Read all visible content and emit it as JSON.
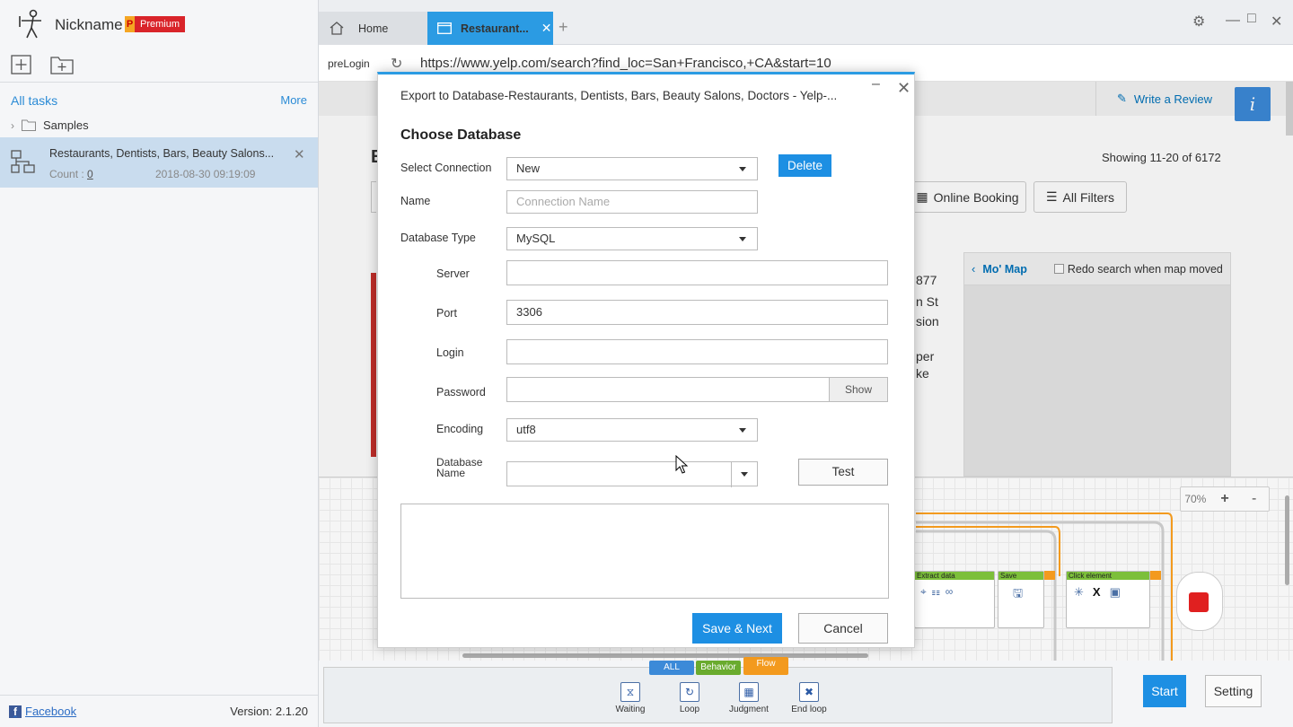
{
  "app": {
    "nickname": "Nickname",
    "premium_badge": "P",
    "premium_label": "Premium"
  },
  "sidebar": {
    "all_tasks": "All tasks",
    "more": "More",
    "folder": "Samples",
    "task": {
      "title": "Restaurants, Dentists, Bars, Beauty Salons...",
      "count_label": "Count : ",
      "count_value": "0",
      "date": "2018-08-30 09:19:09"
    },
    "facebook": "Facebook",
    "version": "Version: 2.1.20"
  },
  "tabs": {
    "home": "Home",
    "active": "Restaurant...",
    "plus": "+"
  },
  "address": {
    "prelogin": "preLogin",
    "url": "https://www.yelp.com/search?find_loc=San+Francisco,+CA&start=10"
  },
  "page": {
    "write_review": "Write a Review",
    "info": "i",
    "showing": "Showing 11-20 of 6172",
    "online_booking": "Online Booking",
    "all_filters": "All Filters",
    "mo_map": "Mo' Map",
    "redo_search": "Redo search when map moved",
    "frag_e": "E",
    "frag_877": "877",
    "frag_nst": "n St",
    "frag_sion": "sion",
    "frag_per": "per",
    "frag_ke": "ke"
  },
  "flow": {
    "zoom": "70%",
    "zoom_in": "+",
    "zoom_out": "-",
    "nodes": {
      "extract": "Extract data",
      "save": "Save",
      "click": "Click element"
    }
  },
  "palette": {
    "tabs": [
      "ALL",
      "Behavior",
      "Flow"
    ],
    "items": [
      "Waiting",
      "Loop",
      "Judgment",
      "End loop"
    ]
  },
  "bottom": {
    "start": "Start",
    "setting": "Setting"
  },
  "dialog": {
    "title": "Export to Database-Restaurants, Dentists, Bars, Beauty Salons, Doctors - Yelp-...",
    "heading": "Choose Database",
    "select_connection_label": "Select Connection",
    "select_connection_value": "New",
    "delete": "Delete",
    "name_label": "Name",
    "name_placeholder": "Connection Name",
    "db_type_label": "Database Type",
    "db_type_value": "MySQL",
    "server_label": "Server",
    "server_value": "",
    "port_label": "Port",
    "port_value": "3306",
    "login_label": "Login",
    "login_value": "",
    "password_label": "Password",
    "password_value": "",
    "show": "Show",
    "encoding_label": "Encoding",
    "encoding_value": "utf8",
    "db_name_label_1": "Database",
    "db_name_label_2": "Name",
    "db_name_value": "",
    "test": "Test",
    "save_next": "Save & Next",
    "cancel": "Cancel"
  },
  "colors": {
    "accent": "#1d8fe3",
    "tab_active": "#2b9be3",
    "premium_red": "#d9242a",
    "node_green": "#7cbf3a",
    "node_orange": "#f39a1e",
    "stop_red": "#e02020"
  }
}
